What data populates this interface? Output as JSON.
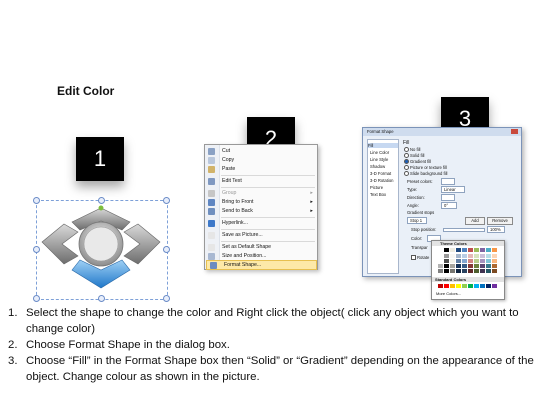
{
  "page_title": "Edit Color",
  "badges": [
    "1",
    "2",
    "3"
  ],
  "context_menu": {
    "items": [
      {
        "label": "Cut",
        "icon": "scissors-icon"
      },
      {
        "label": "Copy",
        "icon": "copy-icon"
      },
      {
        "label": "Paste",
        "icon": "paste-icon"
      },
      {
        "label": "Edit Text",
        "icon": "edit-text-icon"
      },
      {
        "label": "Group",
        "icon": "group-icon",
        "submenu": true
      },
      {
        "label": "Bring to Front",
        "icon": "bring-front-icon",
        "submenu": true
      },
      {
        "label": "Send to Back",
        "icon": "send-back-icon",
        "submenu": true
      },
      {
        "label": "Hyperlink...",
        "icon": "hyperlink-icon"
      },
      {
        "label": "Save as Picture...",
        "icon": "picture-icon"
      },
      {
        "label": "Set as Default Shape",
        "icon": "default-shape-icon"
      },
      {
        "label": "Size and Position...",
        "icon": "size-icon"
      },
      {
        "label": "Format Shape...",
        "icon": "format-shape-icon",
        "highlighted": true
      }
    ],
    "submenu_arrow": "▸"
  },
  "dialog": {
    "title": "Format Shape",
    "categories": [
      "Fill",
      "Line Color",
      "Line Style",
      "Shadow",
      "3-D Format",
      "3-D Rotation",
      "Picture",
      "Text Box"
    ],
    "fill_heading": "Fill",
    "fill_options": [
      "No fill",
      "Solid fill",
      "Gradient fill",
      "Picture or texture fill",
      "Slide background fill"
    ],
    "selected_fill": "Gradient fill",
    "preset_colors_label": "Preset colors:",
    "type_label": "Type:",
    "type_value": "Linear",
    "direction_label": "Direction:",
    "angle_label": "Angle:",
    "angle_value": "0°",
    "gradient_stops_label": "Gradient stops",
    "stop_value": "Stop 1",
    "add_label": "Add",
    "remove_label": "Remove",
    "stop_position_label": "Stop position:",
    "stop_position_value": "100%",
    "color_label": "Color:",
    "transparency_label": "Transpar",
    "rotate_label": "Rotate"
  },
  "palette": {
    "theme_label": "Theme Colors",
    "standard_label": "Standard Colors",
    "more_label": "More Colors...",
    "theme_top": [
      "#ffffff",
      "#000000",
      "#eeece1",
      "#1f497d",
      "#4f81bd",
      "#c0504d",
      "#9bbb59",
      "#8064a2",
      "#4bacc6",
      "#f79646"
    ],
    "standard": [
      "#c00000",
      "#ff0000",
      "#ffc000",
      "#ffff00",
      "#92d050",
      "#00b050",
      "#00b0f0",
      "#0070c0",
      "#002060",
      "#7030a0"
    ]
  },
  "instructions": [
    {
      "num": "1.",
      "text": "Select the shape to change the color and Right click the object( click any object which you want to change color)"
    },
    {
      "num": "2.",
      "text": "Choose Format Shape in the dialog box."
    },
    {
      "num": "3.",
      "text": "Choose “Fill” in the Format Shape box then “Solid” or “Gradient” depending on the appearance of the object. Change colour as shown in the picture."
    }
  ]
}
